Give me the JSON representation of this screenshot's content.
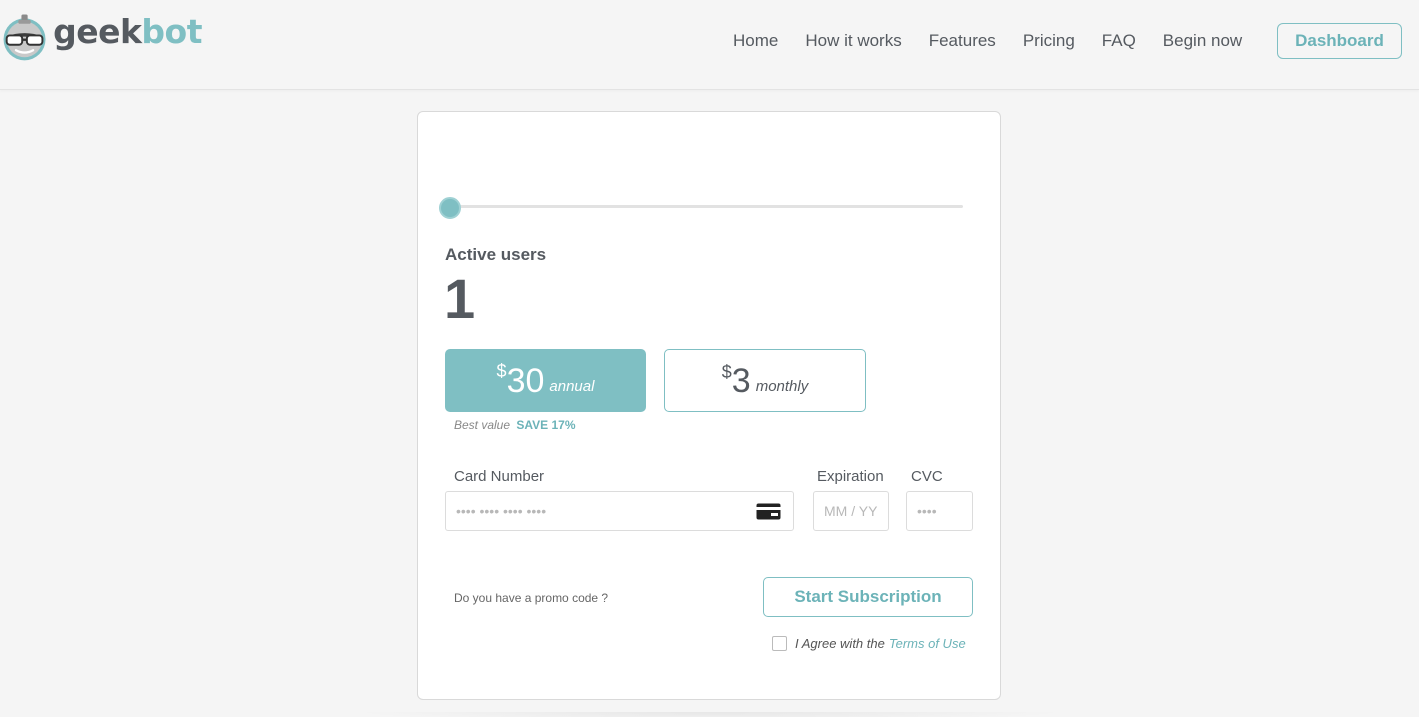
{
  "header": {
    "logo": {
      "part1": "geek",
      "part2": "bot"
    },
    "nav": [
      {
        "label": "Home"
      },
      {
        "label": "How it works"
      },
      {
        "label": "Features"
      },
      {
        "label": "Pricing"
      },
      {
        "label": "FAQ"
      },
      {
        "label": "Begin now"
      }
    ],
    "dashboard_label": "Dashboard"
  },
  "pricing": {
    "slider_fraction": 0.0,
    "users_label": "Active users",
    "users_count": "1",
    "annual": {
      "currency": "$",
      "amount": "30",
      "period": "annual"
    },
    "monthly": {
      "currency": "$",
      "amount": "3",
      "period": "monthly"
    },
    "best_value_label": "Best value",
    "save_label": "SAVE 17%"
  },
  "payment": {
    "card_number_label": "Card Number",
    "card_number_placeholder": "•••• •••• •••• ••••",
    "expiration_label": "Expiration",
    "expiration_placeholder": "MM / YY",
    "cvc_label": "CVC",
    "cvc_placeholder": "••••",
    "promo_text": "Do you have a promo code ?",
    "start_label": "Start Subscription",
    "agree_text": "I Agree with the",
    "terms_label": "Terms of Use"
  },
  "colors": {
    "accent": "#7fbfc3",
    "text": "#555a60",
    "background": "#f5f5f5"
  }
}
